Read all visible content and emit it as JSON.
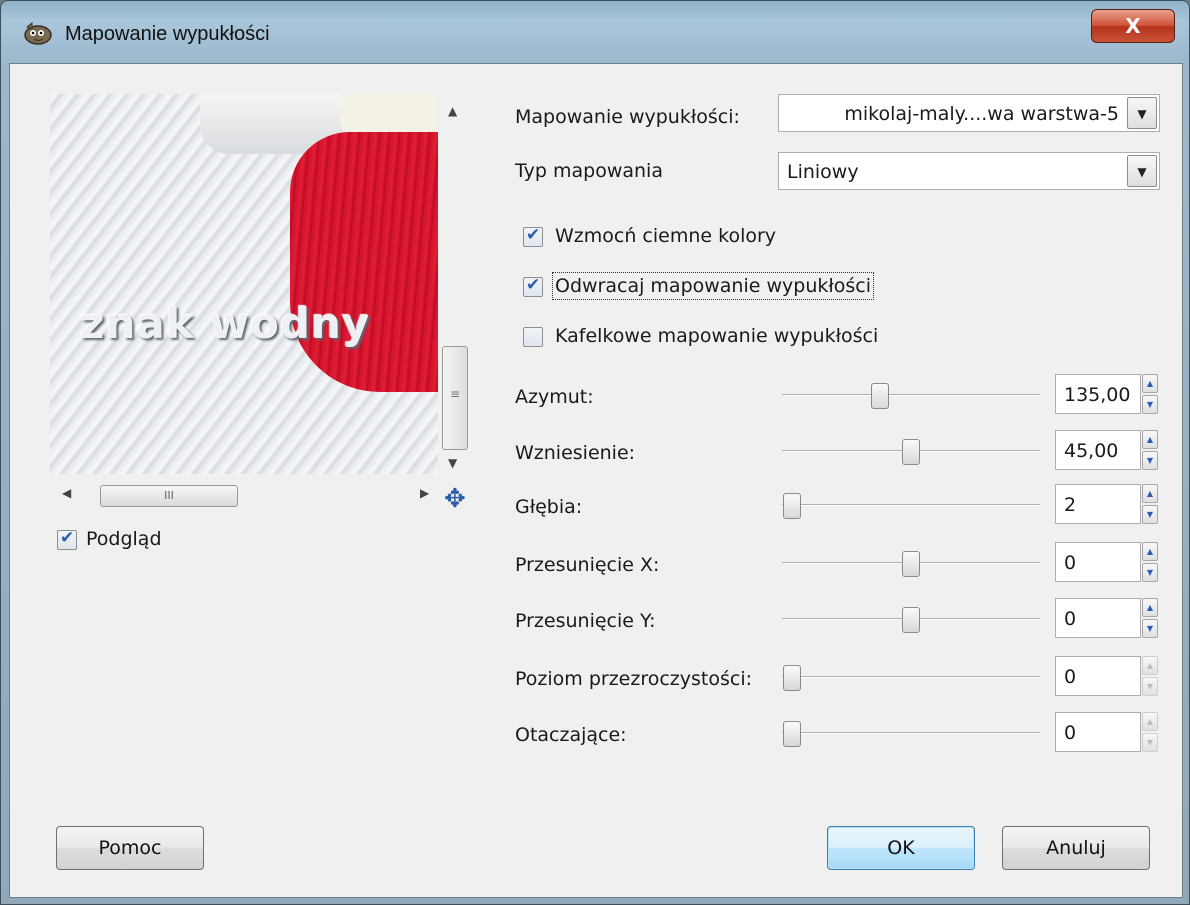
{
  "window": {
    "title": "Mapowanie wypukłości",
    "close_label": "X"
  },
  "preview": {
    "watermark_text": "znak wodny",
    "scroll_thumb_label": "III",
    "preview_checkbox": {
      "label": "Podgląd",
      "checked": true
    }
  },
  "form": {
    "bump_map": {
      "label": "Mapowanie wypukłości:",
      "value": "mikolaj-maly....wa warstwa-5"
    },
    "map_type": {
      "label": "Typ mapowania",
      "value": "Liniowy"
    },
    "checkboxes": [
      {
        "label": "Wzmocń ciemne kolory",
        "checked": true
      },
      {
        "label": "Odwracaj mapowanie wypukłości",
        "checked": true
      },
      {
        "label": "Kafelkowe mapowanie wypukłości",
        "checked": false
      }
    ],
    "sliders": [
      {
        "label": "Azymut:",
        "value": "135,00",
        "level": 0.38
      },
      {
        "label": "Wzniesienie:",
        "value": "45,00",
        "level": 0.5
      },
      {
        "label": "Głębia:",
        "value": "2",
        "level": 0.04
      },
      {
        "label": "Przesunięcie X:",
        "value": "0",
        "level": 0.5
      },
      {
        "label": "Przesunięcie Y:",
        "value": "0",
        "level": 0.5
      },
      {
        "label": "Poziom przezroczystości:",
        "value": "0",
        "level": 0.04
      },
      {
        "label": "Otaczające:",
        "value": "0",
        "level": 0.04
      }
    ]
  },
  "buttons": {
    "help": "Pomoc",
    "ok": "OK",
    "cancel": "Anuluj"
  }
}
